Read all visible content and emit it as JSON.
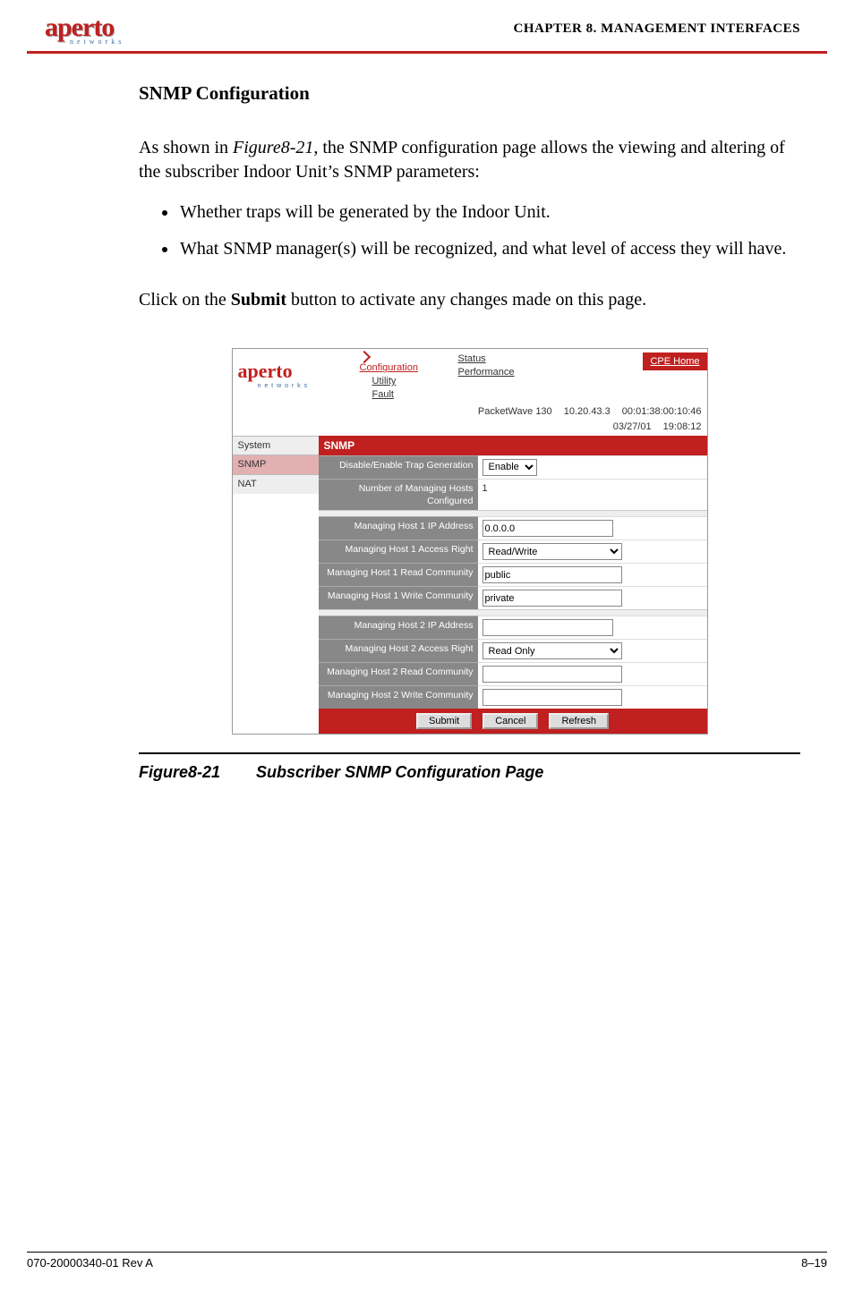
{
  "header": {
    "logo_main": "aperto",
    "logo_sub": "n e t w o r k s",
    "chapter_label": "CHAPTER 8.  ",
    "chapter_title": "MANAGEMENT INTERFACES"
  },
  "section": {
    "title": "SNMP Configuration",
    "intro_pre": "As shown in ",
    "intro_ref": "Figure8-21",
    "intro_post": ", the SNMP configuration page allows the viewing and altering of the subscriber Indoor Unit’s SNMP parameters:",
    "bullets": [
      "Whether traps will be generated by the Indoor Unit.",
      "What SNMP manager(s) will be recognized, and what level of access they will have."
    ],
    "click_pre": "Click on the ",
    "click_bold": "Submit",
    "click_post": " button to activate any changes made on this page."
  },
  "screenshot": {
    "logo_main": "aperto",
    "logo_sub": "n e t w o r k s",
    "tabs": {
      "config": "Configuration",
      "utility": "Utility",
      "fault": "Fault",
      "status": "Status",
      "performance": "Performance",
      "cpe_home": "CPE Home"
    },
    "status_bar": {
      "model": "PacketWave 130",
      "ip": "10.20.43.3",
      "mac": "00:01:38:00:10:46",
      "date": "03/27/01",
      "time": "19:08:12"
    },
    "nav": {
      "system": "System",
      "snmp": "SNMP",
      "nat": "NAT"
    },
    "panel_title": "SNMP",
    "fields": {
      "trap_label": "Disable/Enable Trap Generation",
      "trap_value": "Enable",
      "hosts_label": "Number of Managing Hosts Configured",
      "hosts_value": "1",
      "h1_ip_label": "Managing Host 1 IP Address",
      "h1_ip_value": "0.0.0.0",
      "h1_ar_label": "Managing Host 1 Access Right",
      "h1_ar_value": "Read/Write",
      "h1_rc_label": "Managing Host 1 Read Community",
      "h1_rc_value": "public",
      "h1_wc_label": "Managing Host 1 Write Community",
      "h1_wc_value": "private",
      "h2_ip_label": "Managing Host 2 IP Address",
      "h2_ip_value": "",
      "h2_ar_label": "Managing Host 2 Access Right",
      "h2_ar_value": "Read Only",
      "h2_rc_label": "Managing Host 2 Read Community",
      "h2_rc_value": "",
      "h2_wc_label": "Managing Host 2 Write Community",
      "h2_wc_value": ""
    },
    "buttons": {
      "submit": "Submit",
      "cancel": "Cancel",
      "refresh": "Refresh"
    }
  },
  "figure": {
    "number": "Figure8-21",
    "caption": "Subscriber SNMP Configuration Page"
  },
  "footer": {
    "left": "070-20000340-01 Rev A",
    "right": "8–19"
  }
}
